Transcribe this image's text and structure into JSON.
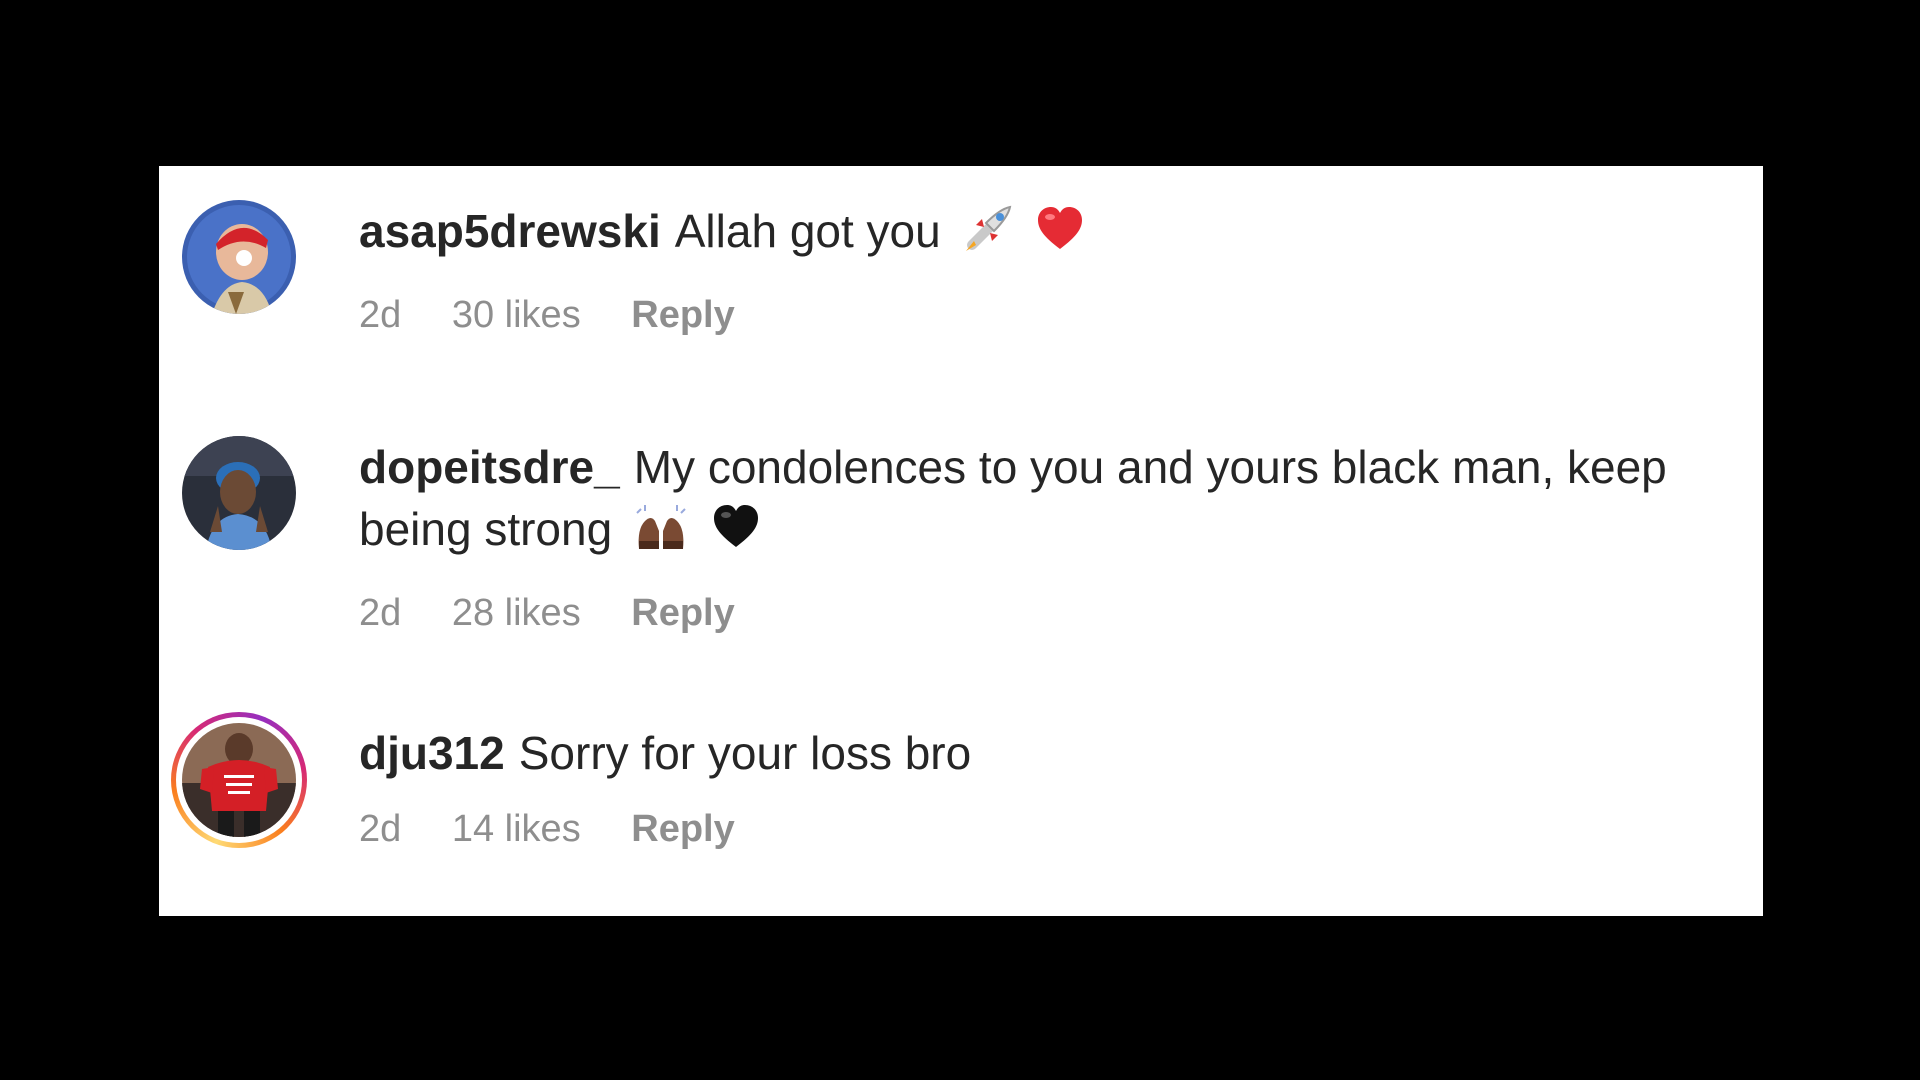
{
  "comments": [
    {
      "username": "asap5drewski",
      "text": "Allah got you",
      "emojis": [
        "rocket-emoji",
        "red-heart-emoji"
      ],
      "time": "2d",
      "likes": "30 likes",
      "reply_label": "Reply"
    },
    {
      "username": "dopeitsdre_",
      "text": "My condolences to you and yours black man, keep being strong",
      "emojis": [
        "raising-hands-emoji",
        "black-heart-emoji"
      ],
      "time": "2d",
      "likes": "28 likes",
      "reply_label": "Reply"
    },
    {
      "username": "dju312",
      "text": "Sorry for your loss bro",
      "emojis": [],
      "time": "2d",
      "likes": "14 likes",
      "reply_label": "Reply"
    }
  ],
  "colors": {
    "background": "#000000",
    "panel": "#ffffff",
    "text": "#262626",
    "meta": "#8e8e8e",
    "story_ring": [
      "#feda75",
      "#fa7e1e",
      "#d62976",
      "#962fbf"
    ]
  }
}
